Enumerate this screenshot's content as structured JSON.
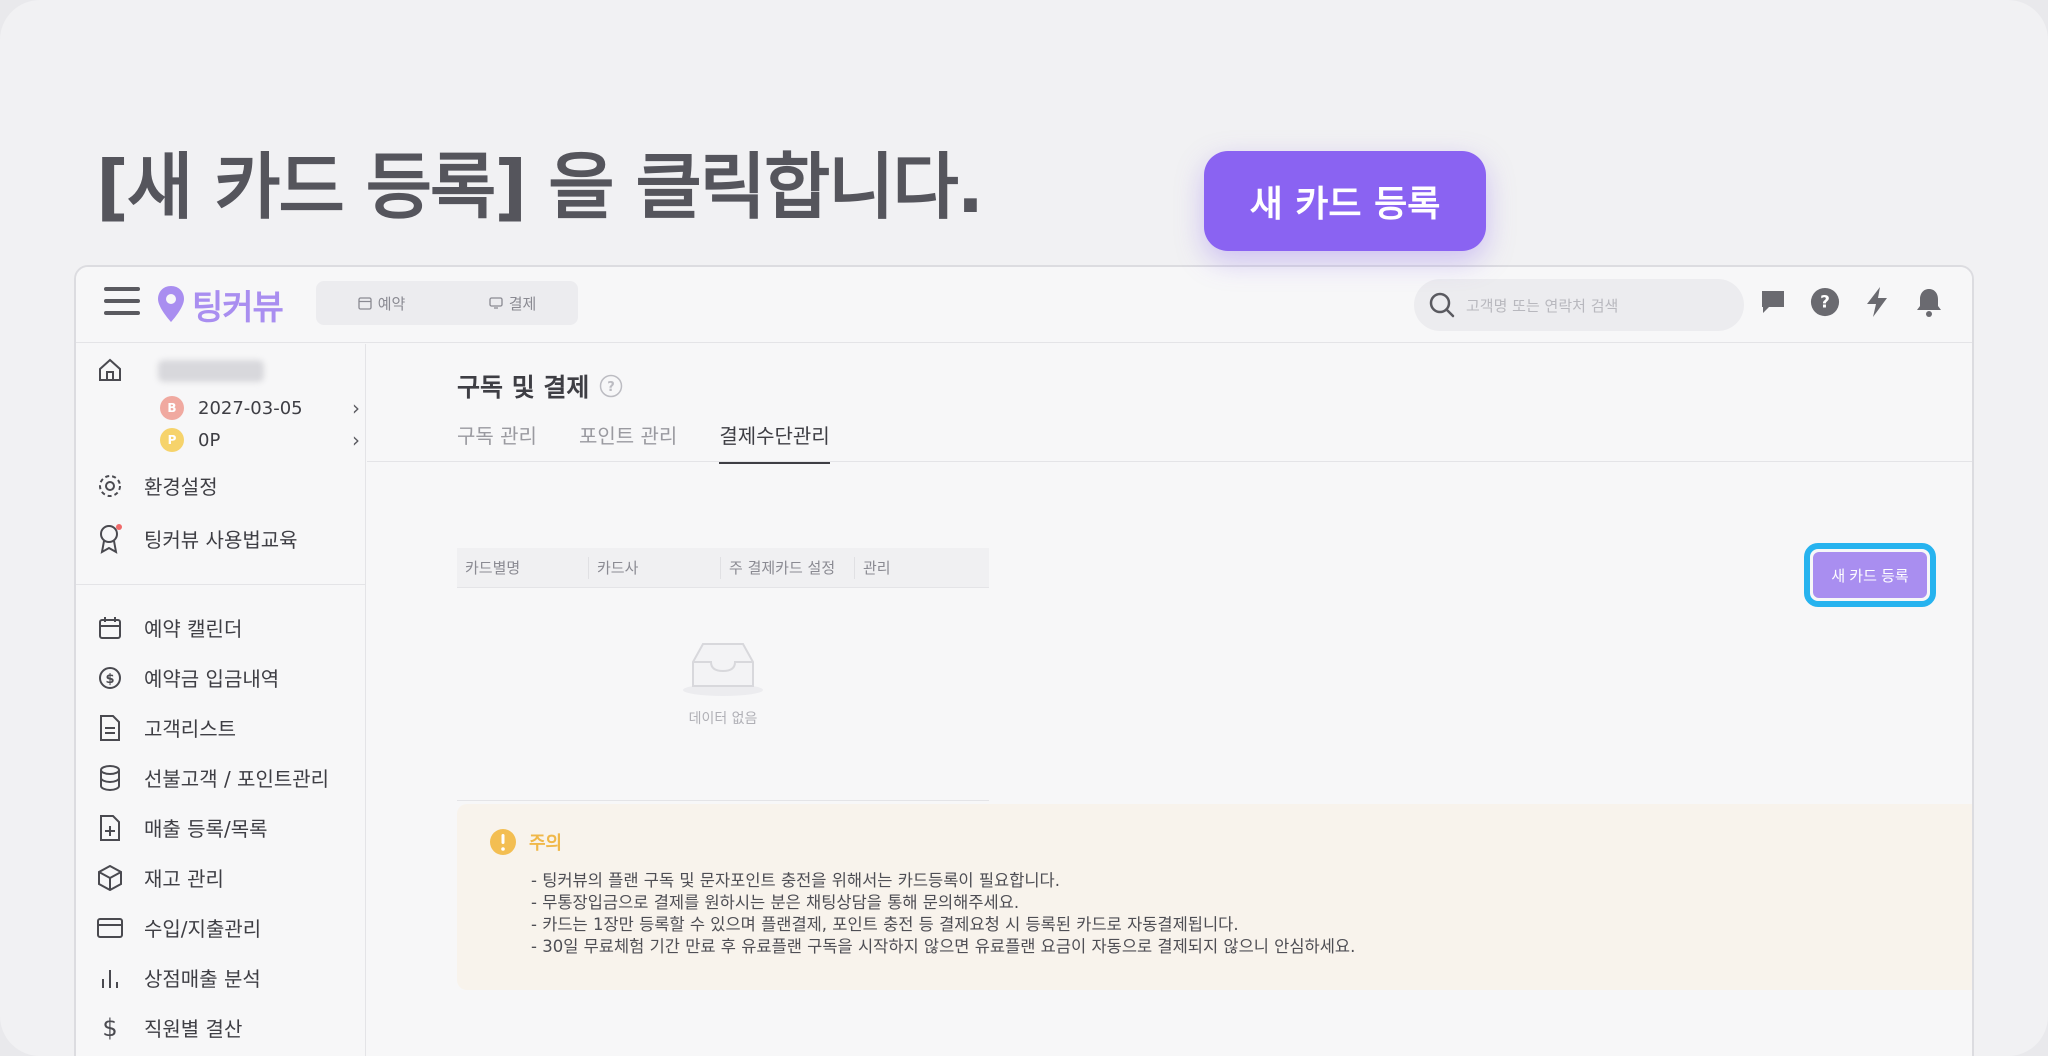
{
  "headline": "[새 카드 등록] 을 클릭합니다.",
  "topbar": {
    "logo_text": "팅커뷰",
    "tabs": [
      {
        "label": "예약",
        "icon": "calendar-icon"
      },
      {
        "label": "결제",
        "icon": "payment-icon"
      }
    ],
    "search_placeholder": "고객명 또는 연락처 검색",
    "icons": [
      "chat-icon",
      "help-icon",
      "bolt-icon",
      "bell-icon"
    ]
  },
  "sidebar": {
    "home_icon": "home-icon",
    "date": "2027-03-05",
    "date_badge": "B",
    "points": "0P",
    "points_badge": "P",
    "items_top": [
      {
        "label": "환경설정",
        "icon": "gear-icon"
      },
      {
        "label": "팅커뷰 사용법교육",
        "icon": "badge-icon"
      }
    ],
    "items": [
      {
        "label": "예약 캘린더",
        "icon": "calendar-icon"
      },
      {
        "label": "예약금 입금내역",
        "icon": "dollar-circle-icon"
      },
      {
        "label": "고객리스트",
        "icon": "document-icon"
      },
      {
        "label": "선불고객 / 포인트관리",
        "icon": "database-icon"
      },
      {
        "label": "매출 등록/목록",
        "icon": "file-plus-icon"
      },
      {
        "label": "재고 관리",
        "icon": "box-icon"
      },
      {
        "label": "수입/지출관리",
        "icon": "card-icon"
      },
      {
        "label": "상점매출 분석",
        "icon": "bar-chart-icon"
      },
      {
        "label": "직원별 결산",
        "icon": "dollar-icon"
      }
    ]
  },
  "main": {
    "title": "구독 및 결제",
    "tabs": [
      "구독 관리",
      "포인트 관리",
      "결제수단관리"
    ],
    "active_tab": "결제수단관리",
    "add_button": "새 카드 등록",
    "table": {
      "headers": [
        "카드별명",
        "카드사",
        "주 결제카드 설정",
        "관리"
      ],
      "empty_text": "데이터 없음"
    },
    "notice": {
      "title": "주의",
      "lines": [
        "- 팅커뷰의 플랜 구독 및 문자포인트 충전을 위해서는 카드등록이 필요합니다.",
        "- 무통장입금으로 결제를 원하시는 분은 채팅상담을 통해 문의해주세요.",
        "- 카드는 1장만 등록할 수 있으며 플랜결제, 포인트 충전 등 결제요청 시 등록된 카드로 자동결제됩니다.",
        "- 30일 무료체험 기간 만료 후 유료플랜 구독을 시작하지 않으면 유료플랜 요금이 자동으로 결제되지 않으니 안심하세요."
      ]
    }
  },
  "callout": "새 카드 등록",
  "colors": {
    "brand": "#a98ef0",
    "callout": "#8a63f2",
    "highlight": "#27b3ef",
    "notice_bg": "#f8f3ec",
    "notice_accent": "#f0b84a"
  }
}
